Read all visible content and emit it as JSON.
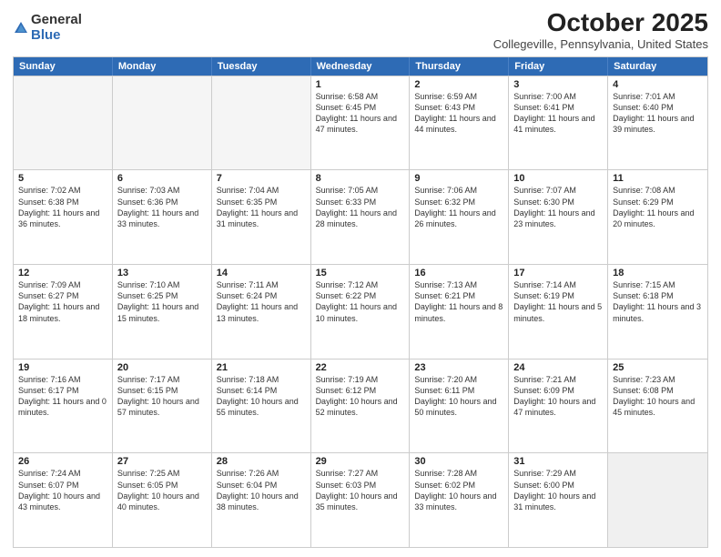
{
  "logo": {
    "general": "General",
    "blue": "Blue"
  },
  "title": "October 2025",
  "location": "Collegeville, Pennsylvania, United States",
  "days_of_week": [
    "Sunday",
    "Monday",
    "Tuesday",
    "Wednesday",
    "Thursday",
    "Friday",
    "Saturday"
  ],
  "rows": [
    [
      {
        "day": "",
        "text": "",
        "empty": true
      },
      {
        "day": "",
        "text": "",
        "empty": true
      },
      {
        "day": "",
        "text": "",
        "empty": true
      },
      {
        "day": "1",
        "text": "Sunrise: 6:58 AM\nSunset: 6:45 PM\nDaylight: 11 hours and 47 minutes."
      },
      {
        "day": "2",
        "text": "Sunrise: 6:59 AM\nSunset: 6:43 PM\nDaylight: 11 hours and 44 minutes."
      },
      {
        "day": "3",
        "text": "Sunrise: 7:00 AM\nSunset: 6:41 PM\nDaylight: 11 hours and 41 minutes."
      },
      {
        "day": "4",
        "text": "Sunrise: 7:01 AM\nSunset: 6:40 PM\nDaylight: 11 hours and 39 minutes."
      }
    ],
    [
      {
        "day": "5",
        "text": "Sunrise: 7:02 AM\nSunset: 6:38 PM\nDaylight: 11 hours and 36 minutes."
      },
      {
        "day": "6",
        "text": "Sunrise: 7:03 AM\nSunset: 6:36 PM\nDaylight: 11 hours and 33 minutes."
      },
      {
        "day": "7",
        "text": "Sunrise: 7:04 AM\nSunset: 6:35 PM\nDaylight: 11 hours and 31 minutes."
      },
      {
        "day": "8",
        "text": "Sunrise: 7:05 AM\nSunset: 6:33 PM\nDaylight: 11 hours and 28 minutes."
      },
      {
        "day": "9",
        "text": "Sunrise: 7:06 AM\nSunset: 6:32 PM\nDaylight: 11 hours and 26 minutes."
      },
      {
        "day": "10",
        "text": "Sunrise: 7:07 AM\nSunset: 6:30 PM\nDaylight: 11 hours and 23 minutes."
      },
      {
        "day": "11",
        "text": "Sunrise: 7:08 AM\nSunset: 6:29 PM\nDaylight: 11 hours and 20 minutes."
      }
    ],
    [
      {
        "day": "12",
        "text": "Sunrise: 7:09 AM\nSunset: 6:27 PM\nDaylight: 11 hours and 18 minutes."
      },
      {
        "day": "13",
        "text": "Sunrise: 7:10 AM\nSunset: 6:25 PM\nDaylight: 11 hours and 15 minutes."
      },
      {
        "day": "14",
        "text": "Sunrise: 7:11 AM\nSunset: 6:24 PM\nDaylight: 11 hours and 13 minutes."
      },
      {
        "day": "15",
        "text": "Sunrise: 7:12 AM\nSunset: 6:22 PM\nDaylight: 11 hours and 10 minutes."
      },
      {
        "day": "16",
        "text": "Sunrise: 7:13 AM\nSunset: 6:21 PM\nDaylight: 11 hours and 8 minutes."
      },
      {
        "day": "17",
        "text": "Sunrise: 7:14 AM\nSunset: 6:19 PM\nDaylight: 11 hours and 5 minutes."
      },
      {
        "day": "18",
        "text": "Sunrise: 7:15 AM\nSunset: 6:18 PM\nDaylight: 11 hours and 3 minutes."
      }
    ],
    [
      {
        "day": "19",
        "text": "Sunrise: 7:16 AM\nSunset: 6:17 PM\nDaylight: 11 hours and 0 minutes."
      },
      {
        "day": "20",
        "text": "Sunrise: 7:17 AM\nSunset: 6:15 PM\nDaylight: 10 hours and 57 minutes."
      },
      {
        "day": "21",
        "text": "Sunrise: 7:18 AM\nSunset: 6:14 PM\nDaylight: 10 hours and 55 minutes."
      },
      {
        "day": "22",
        "text": "Sunrise: 7:19 AM\nSunset: 6:12 PM\nDaylight: 10 hours and 52 minutes."
      },
      {
        "day": "23",
        "text": "Sunrise: 7:20 AM\nSunset: 6:11 PM\nDaylight: 10 hours and 50 minutes."
      },
      {
        "day": "24",
        "text": "Sunrise: 7:21 AM\nSunset: 6:09 PM\nDaylight: 10 hours and 47 minutes."
      },
      {
        "day": "25",
        "text": "Sunrise: 7:23 AM\nSunset: 6:08 PM\nDaylight: 10 hours and 45 minutes."
      }
    ],
    [
      {
        "day": "26",
        "text": "Sunrise: 7:24 AM\nSunset: 6:07 PM\nDaylight: 10 hours and 43 minutes."
      },
      {
        "day": "27",
        "text": "Sunrise: 7:25 AM\nSunset: 6:05 PM\nDaylight: 10 hours and 40 minutes."
      },
      {
        "day": "28",
        "text": "Sunrise: 7:26 AM\nSunset: 6:04 PM\nDaylight: 10 hours and 38 minutes."
      },
      {
        "day": "29",
        "text": "Sunrise: 7:27 AM\nSunset: 6:03 PM\nDaylight: 10 hours and 35 minutes."
      },
      {
        "day": "30",
        "text": "Sunrise: 7:28 AM\nSunset: 6:02 PM\nDaylight: 10 hours and 33 minutes."
      },
      {
        "day": "31",
        "text": "Sunrise: 7:29 AM\nSunset: 6:00 PM\nDaylight: 10 hours and 31 minutes."
      },
      {
        "day": "",
        "text": "",
        "empty": true,
        "shaded": true
      }
    ]
  ]
}
